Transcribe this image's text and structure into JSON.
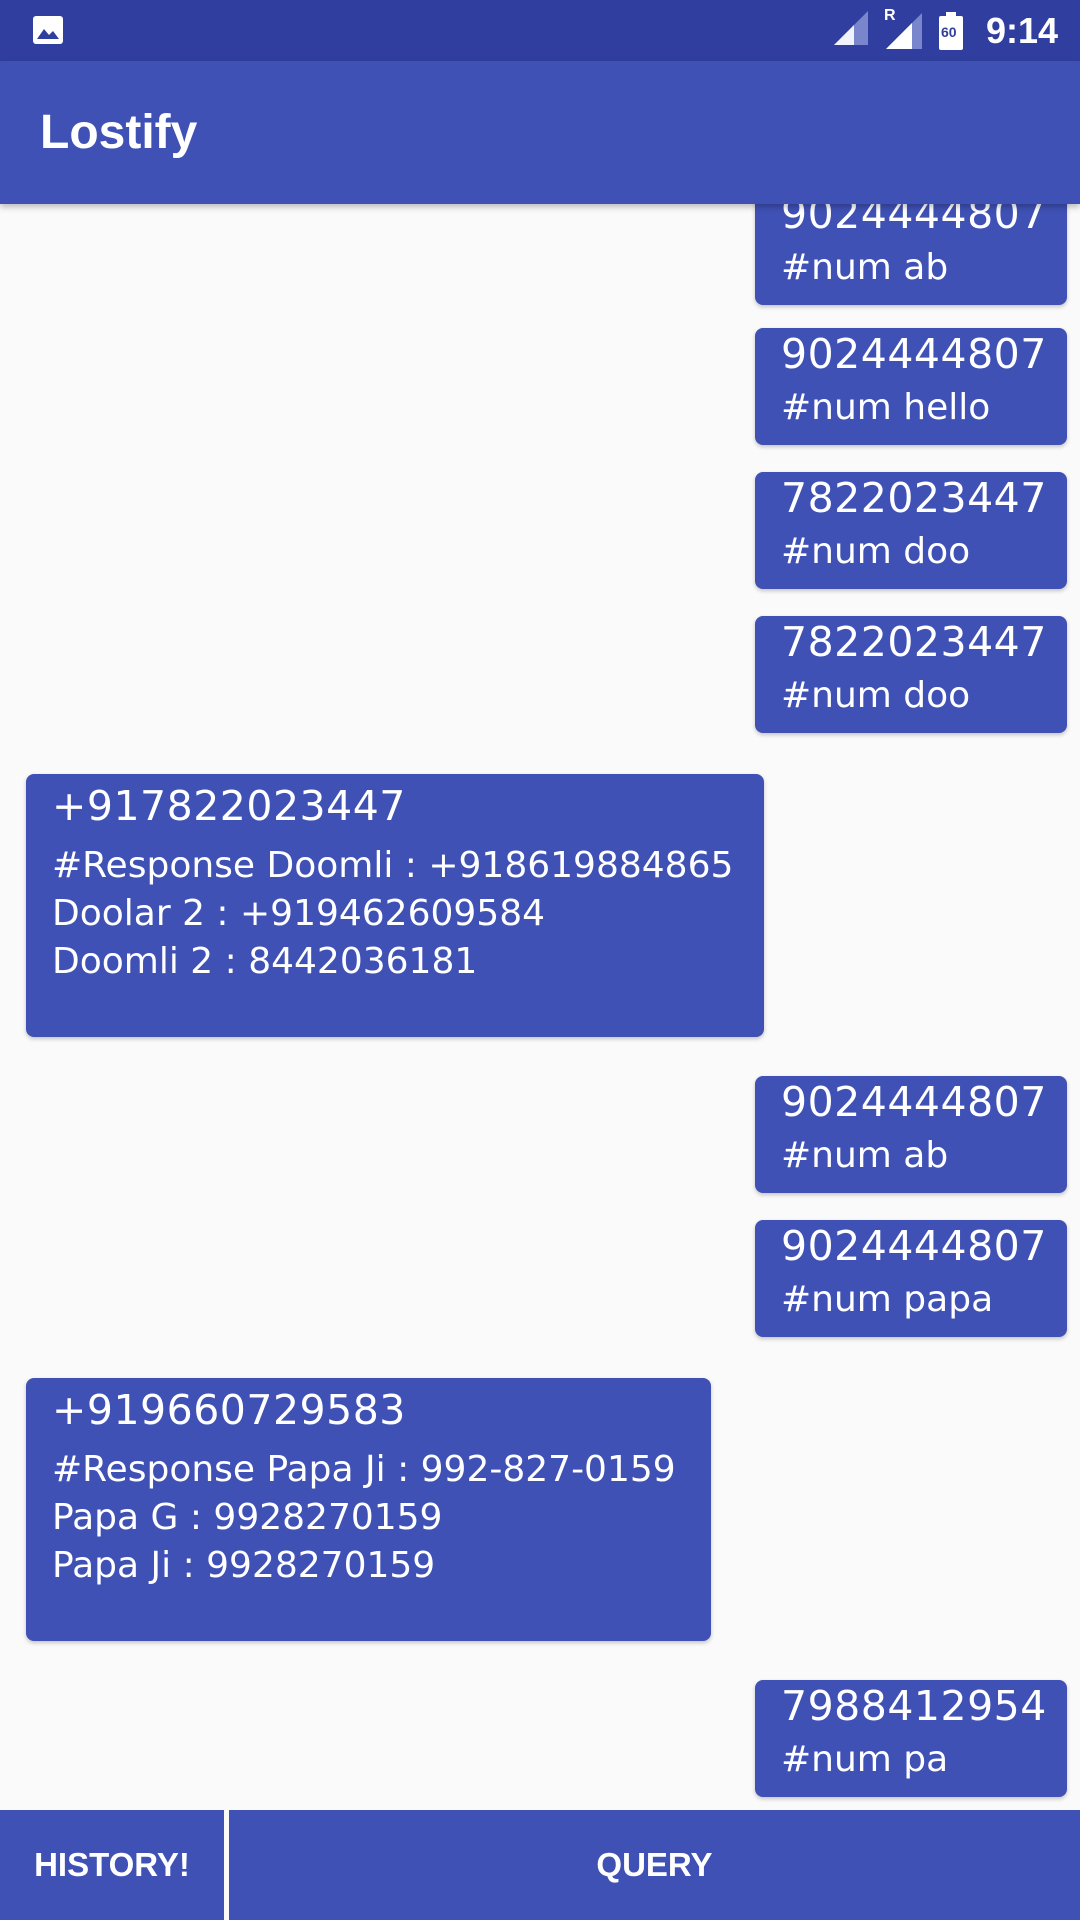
{
  "status_bar": {
    "time": "9:14",
    "network_label": "R",
    "battery_level": "60",
    "icons": [
      "image-icon",
      "signal-icon",
      "roaming-signal-icon",
      "battery-icon"
    ]
  },
  "app_bar": {
    "title": "Lostify"
  },
  "messages": [
    {
      "direction": "out",
      "number": "9024444807",
      "text": "#num ab"
    },
    {
      "direction": "out",
      "number": "9024444807",
      "text": "#num hello"
    },
    {
      "direction": "out",
      "number": "7822023447",
      "text": "#num doo"
    },
    {
      "direction": "out",
      "number": "7822023447",
      "text": "#num doo"
    },
    {
      "direction": "in",
      "number": "+917822023447",
      "text": "#Response Doomli : +918619884865\nDoolar 2 : +919462609584\nDoomli 2 : 8442036181"
    },
    {
      "direction": "out",
      "number": "9024444807",
      "text": "#num ab"
    },
    {
      "direction": "out",
      "number": "9024444807",
      "text": "#num papa"
    },
    {
      "direction": "in",
      "number": "+919660729583",
      "text": "#Response Papa Ji : 992-827-0159\nPapa G : 9928270159\nPapa Ji : 9928270159"
    },
    {
      "direction": "out",
      "number": "7988412954",
      "text": "#num pa"
    }
  ],
  "buttons": {
    "history": "HISTORY!",
    "query": "QUERY"
  },
  "colors": {
    "status_bar": "#303f9f",
    "primary": "#3f51b5",
    "background": "#fafafa",
    "text_on_primary": "#ffffff"
  }
}
